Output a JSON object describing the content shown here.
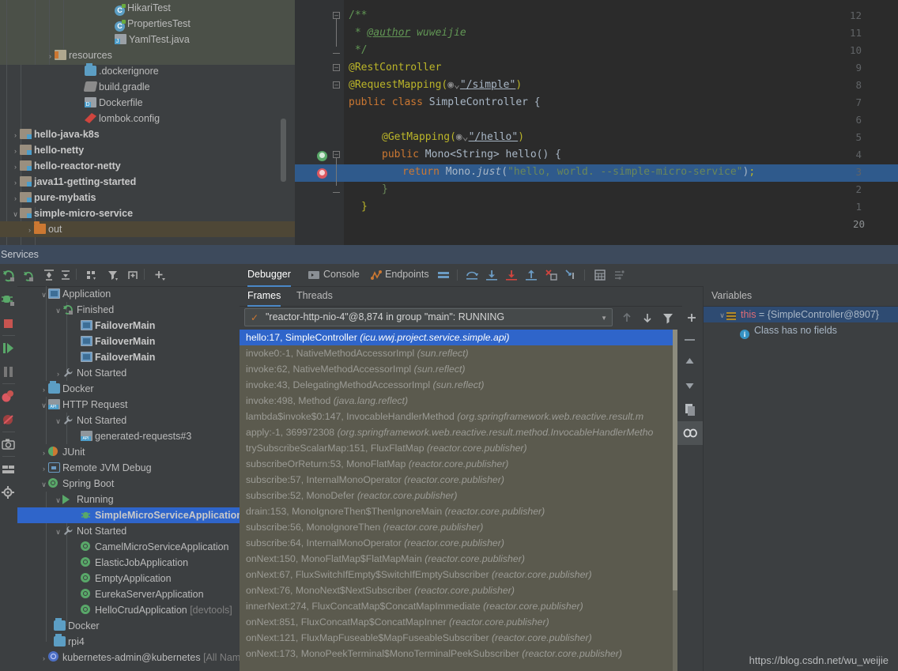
{
  "project_tree": {
    "rows": [
      {
        "indent": 148,
        "icon": "test-class-icon",
        "label": "HikariTest",
        "arrow": "",
        "bold": false
      },
      {
        "indent": 148,
        "icon": "test-class-icon",
        "label": "PropertiesTest",
        "arrow": "",
        "bold": false
      },
      {
        "indent": 148,
        "icon": "java-file-icon",
        "label": "YamlTest.java",
        "arrow": "",
        "bold": false
      },
      {
        "indent": 72,
        "icon": "resources-folder-icon",
        "label": "resources",
        "arrow": "›",
        "bold": false
      },
      {
        "indent": 110,
        "icon": "docker-icon",
        "label": ".dockerignore",
        "arrow": "",
        "bold": false
      },
      {
        "indent": 110,
        "icon": "gradle-icon",
        "label": "build.gradle",
        "arrow": "",
        "bold": false
      },
      {
        "indent": 110,
        "icon": "dockerfile-icon",
        "label": "Dockerfile",
        "arrow": "",
        "bold": false
      },
      {
        "indent": 110,
        "icon": "lombok-icon",
        "label": "lombok.config",
        "arrow": "",
        "bold": false
      },
      {
        "indent": 34,
        "icon": "module-icon",
        "label": "hello-java-k8s",
        "arrow": "›",
        "bold": true
      },
      {
        "indent": 34,
        "icon": "module-icon",
        "label": "hello-netty",
        "arrow": "›",
        "bold": true
      },
      {
        "indent": 34,
        "icon": "module-icon",
        "label": "hello-reactor-netty",
        "arrow": "›",
        "bold": true
      },
      {
        "indent": 34,
        "icon": "module-icon",
        "label": "java11-getting-started",
        "arrow": "›",
        "bold": true
      },
      {
        "indent": 34,
        "icon": "module-icon",
        "label": "pure-mybatis",
        "arrow": "›",
        "bold": true
      },
      {
        "indent": 34,
        "icon": "module-icon",
        "label": "simple-micro-service",
        "arrow": "∨",
        "bold": true
      },
      {
        "indent": 52,
        "icon": "out-folder-icon",
        "label": "out",
        "arrow": "›",
        "bold": false,
        "highlight": true
      }
    ]
  },
  "editor": {
    "line_numbers": [
      "12",
      "11",
      "10",
      "9",
      "8",
      "7",
      "6",
      "5",
      "4",
      "3",
      "2",
      "1"
    ],
    "bottom_line_number": "20",
    "lines": [
      {
        "n": "12",
        "text": "/**"
      },
      {
        "n": "11",
        "text": " * @author wuweijie"
      },
      {
        "n": "10",
        "text": " */"
      },
      {
        "n": "9",
        "text": "@RestController"
      },
      {
        "n": "8",
        "text": "@RequestMapping(\"/simple\")"
      },
      {
        "n": "7",
        "text": "public class SimpleController {"
      },
      {
        "n": "6",
        "text": ""
      },
      {
        "n": "5",
        "text": "    @GetMapping(\"/hello\")"
      },
      {
        "n": "4",
        "text": "    public Mono<String> hello() {"
      },
      {
        "n": "3",
        "text": "        return Mono.just(\"hello, world. --simple-micro-service\");"
      },
      {
        "n": "2",
        "text": "    }"
      },
      {
        "n": "1",
        "text": "}"
      }
    ],
    "author_tag": "@author",
    "author_name": "wuweijie",
    "ann_rest": "@RestController",
    "ann_reqmap": "@RequestMapping(",
    "reqmap_path": "\"/simple\"",
    "ann_getmap": "@GetMapping(",
    "getmap_path": "\"/hello\"",
    "class_decl_kw": "public class ",
    "class_name": "SimpleController",
    "method_kw": "public ",
    "method_sig": "Mono<String> hello() {",
    "return_kw": "return ",
    "return_obj": "Mono.",
    "return_mtd": "just",
    "return_str": "\"hello, world. --simple-micro-service\"",
    "close_brace": "}",
    "close_brace2": "}"
  },
  "services_panel": {
    "title": "Services",
    "toolbar_icons": [
      "rerun-icon",
      "expand-all-icon",
      "collapse-all-icon",
      "group-by-icon",
      "filter-icon",
      "add-tab-icon",
      "add-icon"
    ],
    "left_strip_icons": [
      "rerun-icon",
      "debug-rerun-icon",
      "stop-icon",
      "resume-icon",
      "pause-icon",
      "mute-breakpoints-icon",
      "view-breakpoints-icon",
      "screenshot-icon",
      "layout-icon",
      "settings-icon"
    ],
    "tree": [
      {
        "indent": 28,
        "arrow": "∨",
        "icon": "application-icon",
        "label": "Application",
        "bold": false
      },
      {
        "indent": 46,
        "arrow": "∨",
        "icon": "finished-icon",
        "label": "Finished",
        "bold": false
      },
      {
        "indent": 80,
        "arrow": "",
        "icon": "application-icon",
        "label": "FailoverMain",
        "bold": true
      },
      {
        "indent": 80,
        "arrow": "",
        "icon": "application-icon",
        "label": "FailoverMain",
        "bold": true
      },
      {
        "indent": 80,
        "arrow": "",
        "icon": "application-icon",
        "label": "FailoverMain",
        "bold": true
      },
      {
        "indent": 46,
        "arrow": "›",
        "icon": "wrench-icon",
        "label": "Not Started",
        "bold": false
      },
      {
        "indent": 28,
        "arrow": "›",
        "icon": "docker-icon",
        "label": "Docker",
        "bold": false
      },
      {
        "indent": 28,
        "arrow": "∨",
        "icon": "http-request-icon",
        "label": "HTTP Request",
        "bold": false
      },
      {
        "indent": 46,
        "arrow": "∨",
        "icon": "wrench-icon",
        "label": "Not Started",
        "bold": false
      },
      {
        "indent": 80,
        "arrow": "",
        "icon": "http-request-icon",
        "label": "generated-requests#3",
        "bold": false
      },
      {
        "indent": 28,
        "arrow": "›",
        "icon": "junit-icon",
        "label": "JUnit",
        "bold": false
      },
      {
        "indent": 28,
        "arrow": "›",
        "icon": "remote-jvm-icon",
        "label": "Remote JVM Debug",
        "bold": false
      },
      {
        "indent": 28,
        "arrow": "∨",
        "icon": "spring-boot-icon",
        "label": "Spring Boot",
        "bold": false
      },
      {
        "indent": 46,
        "arrow": "∨",
        "icon": "play-icon",
        "label": "Running",
        "bold": false
      },
      {
        "indent": 80,
        "arrow": "",
        "icon": "debug-bug-icon",
        "label": "SimpleMicroServiceApplication",
        "bold": true,
        "selected": true
      },
      {
        "indent": 46,
        "arrow": "∨",
        "icon": "wrench-icon",
        "label": "Not Started",
        "bold": false
      },
      {
        "indent": 80,
        "arrow": "",
        "icon": "spring-boot-icon",
        "label": "CamelMicroServiceApplication",
        "bold": false
      },
      {
        "indent": 80,
        "arrow": "",
        "icon": "spring-boot-icon",
        "label": "ElasticJobApplication",
        "bold": false
      },
      {
        "indent": 80,
        "arrow": "",
        "icon": "spring-boot-icon",
        "label": "EmptyApplication",
        "bold": false
      },
      {
        "indent": 80,
        "arrow": "",
        "icon": "spring-boot-icon",
        "label": "EurekaServerApplication",
        "bold": false
      },
      {
        "indent": 80,
        "arrow": "",
        "icon": "spring-boot-icon",
        "label": "HelloCrudApplication",
        "suffix": " [devtools]",
        "bold": false
      },
      {
        "indent": 46,
        "arrow": "",
        "icon": "docker-icon",
        "label": "Docker",
        "bold": false
      },
      {
        "indent": 46,
        "arrow": "",
        "icon": "docker-icon",
        "label": "rpi4",
        "bold": false
      },
      {
        "indent": 28,
        "arrow": "›",
        "icon": "kubernetes-icon",
        "label": "kubernetes-admin@kubernetes",
        "suffix": " [All Nam",
        "bold": false
      }
    ]
  },
  "debugger": {
    "tabs": [
      {
        "label": "Debugger",
        "active": true,
        "icon": ""
      },
      {
        "label": "Console",
        "active": false,
        "icon": "console-icon"
      },
      {
        "label": "Endpoints",
        "active": false,
        "icon": "endpoints-icon"
      }
    ],
    "toolbar_icons": [
      "layout-settings-icon",
      "step-over-icon",
      "step-into-icon",
      "force-step-into-icon",
      "step-out-icon",
      "drop-frame-icon",
      "run-to-cursor-icon",
      "evaluate-icon",
      "settings-icon"
    ],
    "frame_tabs": [
      {
        "label": "Frames",
        "active": true
      },
      {
        "label": "Threads",
        "active": false
      }
    ],
    "thread_selector": {
      "value": "\"reactor-http-nio-4\"@8,874 in group \"main\": RUNNING",
      "status_icon": "checkmark-icon",
      "dropdown_icon": "chevron-down-icon"
    },
    "thread_buttons": [
      "up-arrow-icon",
      "down-arrow-icon",
      "filter-icon",
      "add-icon"
    ],
    "side_buttons": [
      "minus-icon",
      "up-triangle-icon",
      "down-triangle-icon",
      "copy-stack-icon",
      "watch-icon"
    ],
    "frames": [
      {
        "method": "hello:17, SimpleController ",
        "pkg": "(icu.wwj.project.service.simple.api)",
        "selected": true
      },
      {
        "method": "invoke0:-1, NativeMethodAccessorImpl ",
        "pkg": "(sun.reflect)"
      },
      {
        "method": "invoke:62, NativeMethodAccessorImpl ",
        "pkg": "(sun.reflect)"
      },
      {
        "method": "invoke:43, DelegatingMethodAccessorImpl ",
        "pkg": "(sun.reflect)"
      },
      {
        "method": "invoke:498, Method ",
        "pkg": "(java.lang.reflect)"
      },
      {
        "method": "lambda$invoke$0:147, InvocableHandlerMethod ",
        "pkg": "(org.springframework.web.reactive.result.m"
      },
      {
        "method": "apply:-1, 369972308 ",
        "pkg": "(org.springframework.web.reactive.result.method.InvocableHandlerMetho"
      },
      {
        "method": "trySubscribeScalarMap:151, FluxFlatMap ",
        "pkg": "(reactor.core.publisher)"
      },
      {
        "method": "subscribeOrReturn:53, MonoFlatMap ",
        "pkg": "(reactor.core.publisher)"
      },
      {
        "method": "subscribe:57, InternalMonoOperator ",
        "pkg": "(reactor.core.publisher)"
      },
      {
        "method": "subscribe:52, MonoDefer ",
        "pkg": "(reactor.core.publisher)"
      },
      {
        "method": "drain:153, MonoIgnoreThen$ThenIgnoreMain ",
        "pkg": "(reactor.core.publisher)"
      },
      {
        "method": "subscribe:56, MonoIgnoreThen ",
        "pkg": "(reactor.core.publisher)"
      },
      {
        "method": "subscribe:64, InternalMonoOperator ",
        "pkg": "(reactor.core.publisher)"
      },
      {
        "method": "onNext:150, MonoFlatMap$FlatMapMain ",
        "pkg": "(reactor.core.publisher)"
      },
      {
        "method": "onNext:67, FluxSwitchIfEmpty$SwitchIfEmptySubscriber ",
        "pkg": "(reactor.core.publisher)"
      },
      {
        "method": "onNext:76, MonoNext$NextSubscriber ",
        "pkg": "(reactor.core.publisher)"
      },
      {
        "method": "innerNext:274, FluxConcatMap$ConcatMapImmediate ",
        "pkg": "(reactor.core.publisher)"
      },
      {
        "method": "onNext:851, FluxConcatMap$ConcatMapInner ",
        "pkg": "(reactor.core.publisher)"
      },
      {
        "method": "onNext:121, FluxMapFuseable$MapFuseableSubscriber ",
        "pkg": "(reactor.core.publisher)"
      },
      {
        "method": "onNext:173, MonoPeekTerminal$MonoTerminalPeekSubscriber ",
        "pkg": "(reactor.core.publisher)"
      }
    ]
  },
  "variables": {
    "header": "Variables",
    "rows": [
      {
        "arrow": "∨",
        "icon": "object-icon",
        "name": "this",
        "eq": " = ",
        "value": "{SimpleController@8907}",
        "selected": true
      },
      {
        "arrow": "",
        "icon": "info-icon",
        "name": "",
        "eq": "",
        "value": "Class has no fields",
        "selected": false
      }
    ]
  },
  "watermark": "https://blog.csdn.net/wu_weijie"
}
